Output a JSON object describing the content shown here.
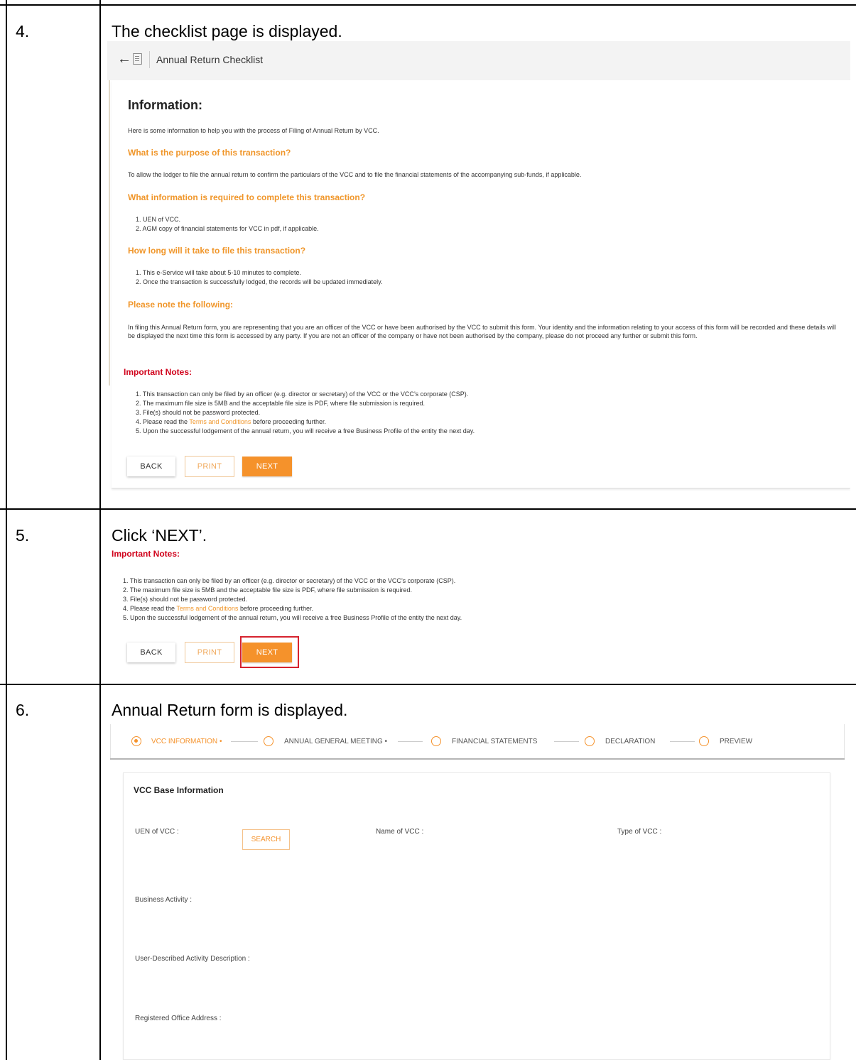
{
  "steps": [
    {
      "number": "4.",
      "description": "The checklist page is displayed."
    },
    {
      "number": "5.",
      "description": "Click ‘NEXT’."
    },
    {
      "number": "6.",
      "description": "Annual Return form is displayed."
    }
  ],
  "checklist": {
    "back_icon": "back-arrow-icon",
    "doc_icon": "document-icon",
    "title": "Annual Return Checklist",
    "info_heading": "Information:",
    "intro": "Here is some information to help you with the process of Filing of Annual Return by VCC.",
    "q1": "What is the purpose of this transaction?",
    "a1": "To allow the lodger to file the annual return to confirm the particulars of the VCC and to file the financial statements of the accompanying sub-funds, if applicable.",
    "q2": "What information is required to complete this transaction?",
    "a2": [
      "1. UEN of VCC.",
      "2. AGM copy of financial statements for VCC in pdf, if applicable."
    ],
    "q3": "How long will it take to file this transaction?",
    "a3": [
      "1. This e-Service will take about 5-10 minutes to complete.",
      "2. Once the transaction is successfully lodged, the records will be updated immediately."
    ],
    "q4": "Please note the following:",
    "a4": "In filing this Annual Return form, you are representing that you are an officer of the VCC or have been authorised by the VCC to submit this form. Your identity and the information relating to your access of this form will be recorded and these details will be displayed the next time this form is accessed by any party. If you are not an officer of the company or have not been authorised by the company, please do not proceed any further or submit this form."
  },
  "important": {
    "heading": "Important Notes:",
    "n1": "1. This transaction can only be filed by an officer (e.g. director or secretary) of the VCC or the VCC’s corporate (CSP).",
    "n2": "2. The maximum file size is 5MB and the acceptable file size is PDF, where file submission is required.",
    "n3": "3. File(s) should not be password protected.",
    "n4_pre": "4. Please read the ",
    "n4_link": "Terms and Conditions",
    "n4_post": " before proceeding further.",
    "n5": "5. Upon the successful lodgement of the annual return, you will receive a free Business Profile of the entity the next day."
  },
  "buttons": {
    "back": "BACK",
    "print": "PRINT",
    "next": "NEXT"
  },
  "form": {
    "steps": [
      "VCC INFORMATION",
      "ANNUAL GENERAL MEETING",
      "FINANCIAL STATEMENTS",
      "DECLARATION",
      "PREVIEW"
    ],
    "required_mark": "•",
    "section_title": "VCC Base Information",
    "uen_label": "UEN of VCC :",
    "search": "SEARCH",
    "name_label": "Name of VCC :",
    "type_label": "Type of VCC :",
    "activity_label": "Business Activity :",
    "user_desc_label": "User-Described Activity Description :",
    "address_label": "Registered Office Address :"
  },
  "colors": {
    "accent": "#f5922b",
    "important": "#d0021b",
    "highlight": "#d6232e"
  }
}
